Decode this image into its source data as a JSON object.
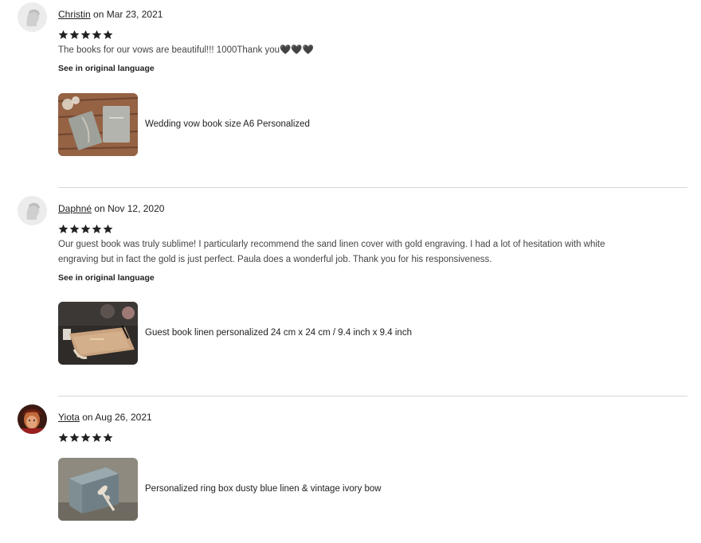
{
  "reviews": [
    {
      "author": "Christin",
      "date": "on Mar 23, 2021",
      "rating": 5,
      "text": "The books for our vows are beautiful!!! 1000Thank you🖤🖤🖤",
      "see_original": "See in original language",
      "product": "Wedding vow book size A6 Personalized"
    },
    {
      "author": "Daphné",
      "date": "on Nov 12, 2020",
      "rating": 5,
      "text": "Our guest book was truly sublime! I particularly recommend the sand linen cover with gold engraving. I had a lot of hesitation with white engraving but in fact the gold is just perfect. Paula does a wonderful job. Thank you for his responsiveness.",
      "see_original": "See in original language",
      "product": "Guest book linen personalized 24 cm x 24 cm / 9.4 inch x 9.4 inch"
    },
    {
      "author": "Yiota",
      "date": "on Aug 26, 2021",
      "rating": 5,
      "product": "Personalized ring box dusty blue linen & vintage ivory bow"
    }
  ],
  "colors": {
    "star": "#222222",
    "divider": "#d7d7d7",
    "text": "#444444"
  }
}
